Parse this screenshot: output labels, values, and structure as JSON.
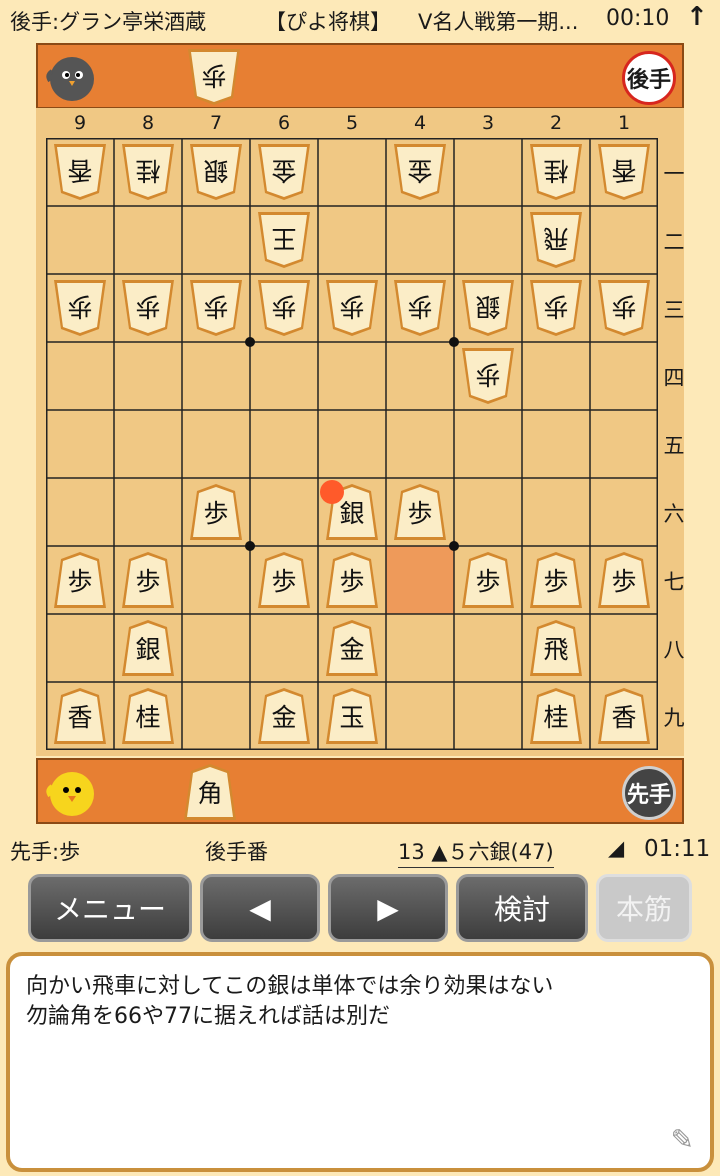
{
  "header": {
    "player": "後手:グラン亭栄酒蔵",
    "app": "【ぴよ将棋】",
    "event": "V名人戦第一期...",
    "time": "00:10",
    "arrow": "↑"
  },
  "gote_stand": {
    "badge": "後手",
    "hand": [
      {
        "kanji": "歩",
        "red": false
      }
    ]
  },
  "sente_stand": {
    "badge": "先手",
    "hand": [
      {
        "kanji": "角",
        "red": false
      }
    ]
  },
  "files": [
    "9",
    "8",
    "7",
    "6",
    "5",
    "4",
    "3",
    "2",
    "1"
  ],
  "ranks": [
    "一",
    "二",
    "三",
    "四",
    "五",
    "六",
    "七",
    "八",
    "九"
  ],
  "last_move": {
    "file": 4,
    "rank": 7
  },
  "move_marker": {
    "file": 5,
    "rank": 6
  },
  "pieces": [
    {
      "file": 9,
      "rank": 1,
      "kanji": "香",
      "owner": "gote",
      "red": false
    },
    {
      "file": 8,
      "rank": 1,
      "kanji": "桂",
      "owner": "gote",
      "red": false
    },
    {
      "file": 7,
      "rank": 1,
      "kanji": "銀",
      "owner": "gote",
      "red": false
    },
    {
      "file": 6,
      "rank": 1,
      "kanji": "金",
      "owner": "gote",
      "red": false
    },
    {
      "file": 4,
      "rank": 1,
      "kanji": "金",
      "owner": "gote",
      "red": false
    },
    {
      "file": 2,
      "rank": 1,
      "kanji": "桂",
      "owner": "gote",
      "red": false
    },
    {
      "file": 1,
      "rank": 1,
      "kanji": "香",
      "owner": "gote",
      "red": false
    },
    {
      "file": 6,
      "rank": 2,
      "kanji": "王",
      "owner": "gote",
      "red": false
    },
    {
      "file": 2,
      "rank": 2,
      "kanji": "飛",
      "owner": "gote",
      "red": false
    },
    {
      "file": 9,
      "rank": 3,
      "kanji": "歩",
      "owner": "gote",
      "red": false
    },
    {
      "file": 8,
      "rank": 3,
      "kanji": "歩",
      "owner": "gote",
      "red": false
    },
    {
      "file": 7,
      "rank": 3,
      "kanji": "歩",
      "owner": "gote",
      "red": false
    },
    {
      "file": 6,
      "rank": 3,
      "kanji": "歩",
      "owner": "gote",
      "red": false
    },
    {
      "file": 5,
      "rank": 3,
      "kanji": "歩",
      "owner": "gote",
      "red": false
    },
    {
      "file": 4,
      "rank": 3,
      "kanji": "歩",
      "owner": "gote",
      "red": false
    },
    {
      "file": 3,
      "rank": 3,
      "kanji": "銀",
      "owner": "gote",
      "red": false
    },
    {
      "file": 2,
      "rank": 3,
      "kanji": "歩",
      "owner": "gote",
      "red": false
    },
    {
      "file": 1,
      "rank": 3,
      "kanji": "歩",
      "owner": "gote",
      "red": false
    },
    {
      "file": 3,
      "rank": 4,
      "kanji": "歩",
      "owner": "gote",
      "red": false
    },
    {
      "file": 7,
      "rank": 6,
      "kanji": "歩",
      "owner": "sente",
      "red": false
    },
    {
      "file": 5,
      "rank": 6,
      "kanji": "銀",
      "owner": "sente",
      "red": false
    },
    {
      "file": 4,
      "rank": 6,
      "kanji": "歩",
      "owner": "sente",
      "red": false
    },
    {
      "file": 9,
      "rank": 7,
      "kanji": "歩",
      "owner": "sente",
      "red": false
    },
    {
      "file": 8,
      "rank": 7,
      "kanji": "歩",
      "owner": "sente",
      "red": false
    },
    {
      "file": 6,
      "rank": 7,
      "kanji": "歩",
      "owner": "sente",
      "red": false
    },
    {
      "file": 5,
      "rank": 7,
      "kanji": "歩",
      "owner": "sente",
      "red": false
    },
    {
      "file": 3,
      "rank": 7,
      "kanji": "歩",
      "owner": "sente",
      "red": false
    },
    {
      "file": 2,
      "rank": 7,
      "kanji": "歩",
      "owner": "sente",
      "red": false
    },
    {
      "file": 1,
      "rank": 7,
      "kanji": "歩",
      "owner": "sente",
      "red": false
    },
    {
      "file": 8,
      "rank": 8,
      "kanji": "銀",
      "owner": "sente",
      "red": false
    },
    {
      "file": 5,
      "rank": 8,
      "kanji": "金",
      "owner": "sente",
      "red": false
    },
    {
      "file": 2,
      "rank": 8,
      "kanji": "飛",
      "owner": "sente",
      "red": false
    },
    {
      "file": 9,
      "rank": 9,
      "kanji": "香",
      "owner": "sente",
      "red": false
    },
    {
      "file": 8,
      "rank": 9,
      "kanji": "桂",
      "owner": "sente",
      "red": false
    },
    {
      "file": 6,
      "rank": 9,
      "kanji": "金",
      "owner": "sente",
      "red": false
    },
    {
      "file": 5,
      "rank": 9,
      "kanji": "玉",
      "owner": "sente",
      "red": false
    },
    {
      "file": 2,
      "rank": 9,
      "kanji": "桂",
      "owner": "sente",
      "red": false
    },
    {
      "file": 1,
      "rank": 9,
      "kanji": "香",
      "owner": "sente",
      "red": false
    }
  ],
  "info": {
    "hand": "先手:歩",
    "turn": "後手番",
    "move": "13 ▲５六銀(47)",
    "triangle": "◢",
    "clock": "01:11"
  },
  "buttons": {
    "menu": "メニュー",
    "back": "◀",
    "forward": "▶",
    "analyze": "検討",
    "mainline": "本筋"
  },
  "comment": {
    "line1": "向かい飛車に対してこの銀は単体では余り効果はない",
    "line2": "勿論角を66や77に据えれば話は別だ"
  },
  "colors": {
    "background": "#fde9b8",
    "stand": "#e77f33",
    "board": "#f0c884",
    "last_move": "#ee9a5a",
    "marker": "#ff5a2a"
  }
}
